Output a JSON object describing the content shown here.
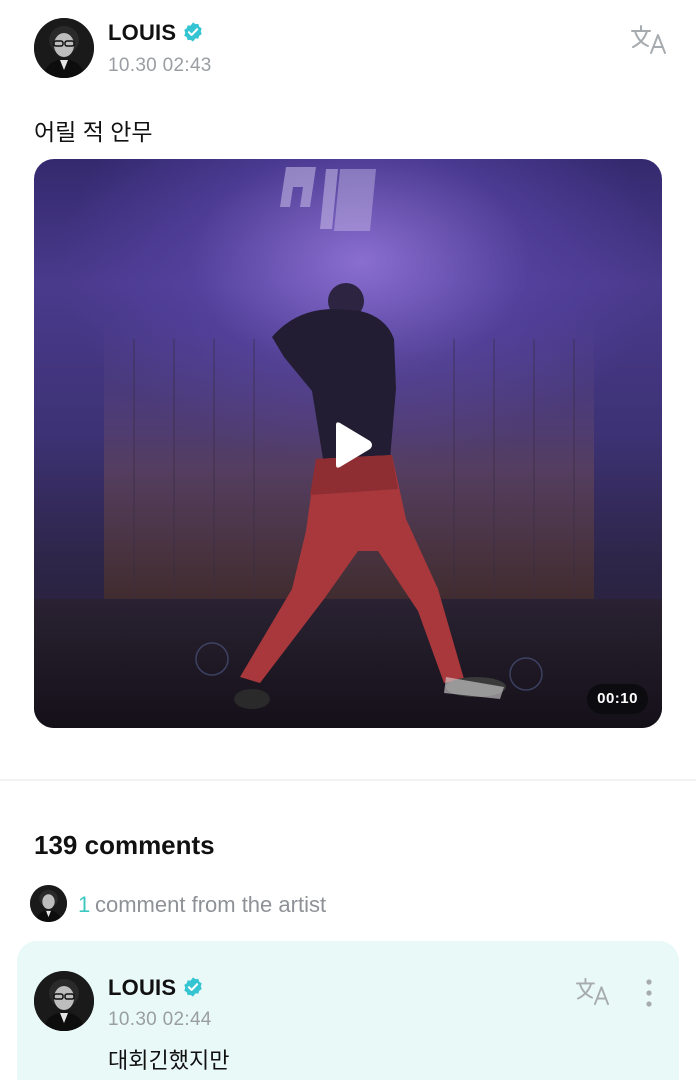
{
  "post": {
    "author": {
      "name": "LOUIS",
      "verified": true,
      "avatar": "avatar-photo"
    },
    "timestamp": "10.30 02:43",
    "translate_icon": "translate-icon",
    "text": "어릴 적 안무",
    "video": {
      "duration": "00:10",
      "play_icon": "play-icon"
    }
  },
  "comments": {
    "count_label": "139 comments",
    "artist_comments": {
      "count": "1",
      "label": "comment from the artist"
    },
    "items": [
      {
        "author": "LOUIS",
        "verified": true,
        "timestamp": "10.30 02:44",
        "text": "대회긴했지만",
        "translate_icon": "translate-icon",
        "more_icon": "more-vertical-icon"
      }
    ]
  },
  "colors": {
    "accent_teal": "#3cc8c0",
    "verified_badge": "#35c4d2",
    "artist_card_bg": "#e9f9f7",
    "muted_text": "#9a9ea3"
  }
}
